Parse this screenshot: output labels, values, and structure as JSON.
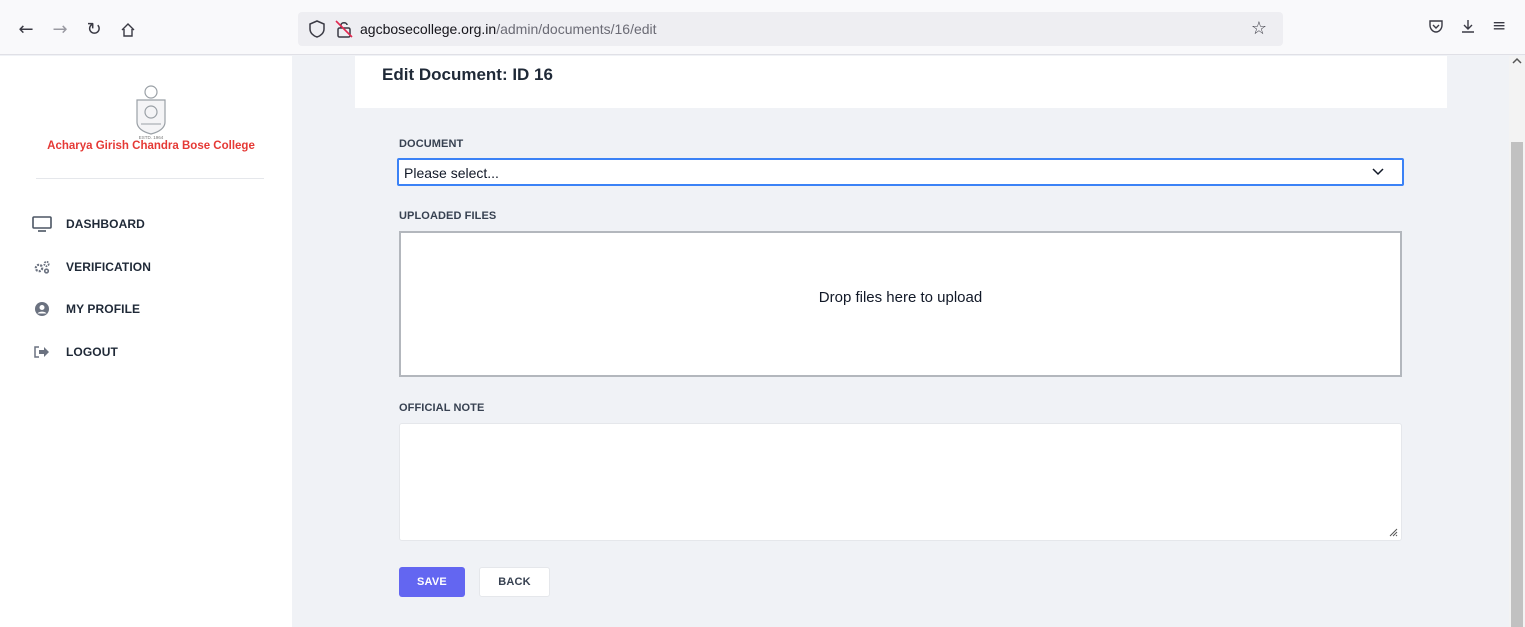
{
  "browser": {
    "url_domain": "agcbosecollege.org.in",
    "url_path": "/admin/documents/16/edit",
    "icons": [
      "back-arrow-icon",
      "forward-arrow-icon",
      "reload-icon",
      "home-icon",
      "shield-icon",
      "insecure-lock-icon",
      "bookmark-star-icon",
      "pocket-icon",
      "download-icon",
      "menu-icon"
    ]
  },
  "sidebar": {
    "college_name": "Acharya Girish Chandra Bose College",
    "logo_estd": "ESTD. 1964",
    "items": [
      {
        "label": "DASHBOARD",
        "icon": "monitor-icon"
      },
      {
        "label": "VERIFICATION",
        "icon": "gears-icon"
      },
      {
        "label": "MY PROFILE",
        "icon": "user-circle-icon"
      },
      {
        "label": "LOGOUT",
        "icon": "sign-out-icon"
      }
    ]
  },
  "main": {
    "title": "Edit Document: ID 16",
    "document_label": "DOCUMENT",
    "document_select_value": "Please select...",
    "uploaded_files_label": "UPLOADED FILES",
    "dropzone_text": "Drop files here to upload",
    "official_note_label": "OFFICIAL NOTE",
    "official_note_value": "",
    "save_label": "SAVE",
    "back_label": "BACK"
  },
  "colors": {
    "accent": "#6366f1",
    "focus_border": "#3b82f6",
    "college_name": "#e53935",
    "page_background": "#f0f2f6"
  }
}
